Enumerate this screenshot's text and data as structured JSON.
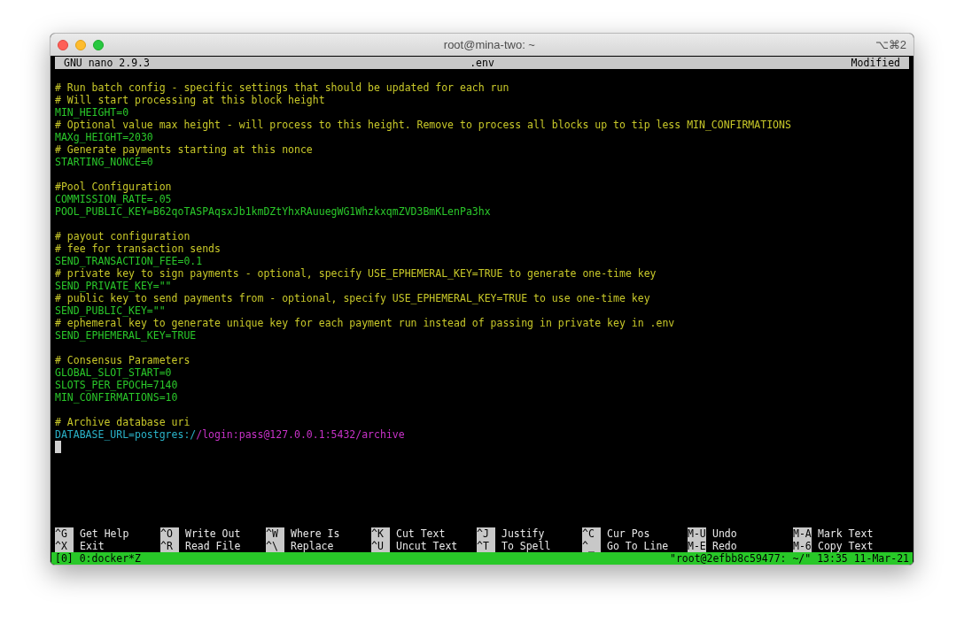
{
  "window": {
    "title": "root@mina-two: ~",
    "shortcut": "⌥⌘2"
  },
  "nano_header": {
    "app": "GNU nano 2.9.3",
    "file": ".env",
    "modified": true,
    "modified_label": "Modified"
  },
  "lines": [
    {
      "kind": "comment",
      "text": "# Run batch config - specific settings that should be updated for each run"
    },
    {
      "kind": "comment",
      "text": "# Will start processing at this block height"
    },
    {
      "kind": "setting",
      "text": "MIN_HEIGHT=0"
    },
    {
      "kind": "comment",
      "text": "# Optional value max height - will process to this height. Remove to process all blocks up to tip less MIN_CONFIRMATIONS"
    },
    {
      "kind": "setting",
      "text": "MAXg_HEIGHT=2030"
    },
    {
      "kind": "comment",
      "text": "# Generate payments starting at this nonce"
    },
    {
      "kind": "setting",
      "text": "STARTING_NONCE=0"
    },
    {
      "kind": "blank"
    },
    {
      "kind": "comment",
      "text": "#Pool Configuration"
    },
    {
      "kind": "setting",
      "text": "COMMISSION_RATE=.05"
    },
    {
      "kind": "setting",
      "text": "POOL_PUBLIC_KEY=B62qoTASPAqsxJb1kmDZtYhxRAuuegWG1WhzkxqmZVD3BmKLenPa3hx"
    },
    {
      "kind": "blank"
    },
    {
      "kind": "comment",
      "text": "# payout configuration"
    },
    {
      "kind": "comment",
      "text": "# fee for transaction sends"
    },
    {
      "kind": "setting",
      "text": "SEND_TRANSACTION_FEE=0.1"
    },
    {
      "kind": "comment",
      "text": "# private key to sign payments - optional, specify USE_EPHEMERAL_KEY=TRUE to generate one-time key"
    },
    {
      "kind": "setting",
      "text": "SEND_PRIVATE_KEY=\"\""
    },
    {
      "kind": "comment",
      "text": "# public key to send payments from - optional, specify USE_EPHEMERAL_KEY=TRUE to use one-time key"
    },
    {
      "kind": "setting",
      "text": "SEND_PUBLIC_KEY=\"\""
    },
    {
      "kind": "comment",
      "text": "# ephemeral key to generate unique key for each payment run instead of passing in private key in .env"
    },
    {
      "kind": "setting",
      "text": "SEND_EPHEMERAL_KEY=TRUE"
    },
    {
      "kind": "blank"
    },
    {
      "kind": "comment",
      "text": "# Consensus Parameters"
    },
    {
      "kind": "setting",
      "text": "GLOBAL_SLOT_START=0"
    },
    {
      "kind": "setting",
      "text": "SLOTS_PER_EPOCH=7140"
    },
    {
      "kind": "setting",
      "text": "MIN_CONFIRMATIONS=10"
    },
    {
      "kind": "blank"
    },
    {
      "kind": "comment",
      "text": "# Archive database uri"
    },
    {
      "kind": "url",
      "text": "DATABASE_URL=postgres:/",
      "value": "/login:pass@127.0.0.1:5432/archive"
    }
  ],
  "cursor_visible": true,
  "shortcuts": [
    {
      "key": "^G",
      "label": "Get Help"
    },
    {
      "key": "^O",
      "label": "Write Out"
    },
    {
      "key": "^W",
      "label": "Where Is"
    },
    {
      "key": "^K",
      "label": "Cut Text"
    },
    {
      "key": "^J",
      "label": "Justify"
    },
    {
      "key": "^C",
      "label": "Cur Pos"
    },
    {
      "key": "M-U",
      "label": "Undo"
    },
    {
      "key": "M-A",
      "label": "Mark Text"
    },
    {
      "key": "^X",
      "label": "Exit"
    },
    {
      "key": "^R",
      "label": "Read File"
    },
    {
      "key": "^\\",
      "label": "Replace"
    },
    {
      "key": "^U",
      "label": "Uncut Text"
    },
    {
      "key": "^T",
      "label": "To Spell"
    },
    {
      "key": "^_",
      "label": "Go To Line"
    },
    {
      "key": "M-E",
      "label": "Redo"
    },
    {
      "key": "M-6",
      "label": "Copy Text"
    }
  ],
  "status_bar": {
    "window_list": "[0] 0:docker*Z",
    "host": "\"root@2efbb8c59477: ~/\" 13:35 11-Mar-21"
  }
}
